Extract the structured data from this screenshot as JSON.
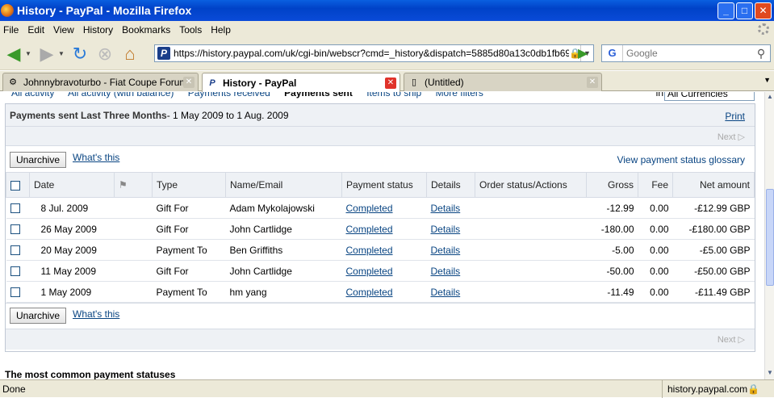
{
  "window": {
    "title": "History - PayPal - Mozilla Firefox",
    "minimize": "_",
    "maximize": "□",
    "close": "✕"
  },
  "menu": [
    "File",
    "Edit",
    "View",
    "History",
    "Bookmarks",
    "Tools",
    "Help"
  ],
  "nav": {
    "url": "https://history.paypal.com/uk/cgi-bin/webscr?cmd=_history&dispatch=5885d80a13c0db1fb69",
    "search_placeholder": "Google",
    "search_engine": "G"
  },
  "tabs": [
    {
      "label": "Johnnybravoturbo - Fiat Coupe Forum",
      "icon": "forum-icon",
      "active": false
    },
    {
      "label": "History - PayPal",
      "icon": "paypal-icon",
      "active": true
    },
    {
      "label": "(Untitled)",
      "icon": "page-icon",
      "active": false
    }
  ],
  "page": {
    "subnav": [
      "All activity",
      "All activity (with balance)",
      "Payments received",
      "Payments sent",
      "Items to ship",
      "More filters"
    ],
    "currency_label": "in",
    "currency_value": "All Currencies",
    "panel_title": "Payments sent Last Three Months",
    "panel_range": " - 1 May 2009 to 1 Aug. 2009",
    "print": "Print",
    "next": "Next",
    "unarchive": "Unarchive",
    "whats_this": "What's this",
    "glossary": "View payment status glossary",
    "columns": [
      "Date",
      "",
      "Type",
      "Name/Email",
      "Payment status",
      "Details",
      "Order status/Actions",
      "Gross",
      "Fee",
      "Net amount"
    ],
    "rows": [
      {
        "date": "8 Jul. 2009",
        "type": "Gift For",
        "name": "Adam Mykolajowski",
        "status": "Completed",
        "details": "Details",
        "gross": "-12.99",
        "fee": "0.00",
        "net": "-£12.99 GBP"
      },
      {
        "date": "26 May 2009",
        "type": "Gift For",
        "name": "John Cartlidge",
        "status": "Completed",
        "details": "Details",
        "gross": "-180.00",
        "fee": "0.00",
        "net": "-£180.00 GBP"
      },
      {
        "date": "20 May 2009",
        "type": "Payment To",
        "name": "Ben Griffiths",
        "status": "Completed",
        "details": "Details",
        "gross": "-5.00",
        "fee": "0.00",
        "net": "-£5.00 GBP"
      },
      {
        "date": "11 May 2009",
        "type": "Gift For",
        "name": "John Cartlidge",
        "status": "Completed",
        "details": "Details",
        "gross": "-50.00",
        "fee": "0.00",
        "net": "-£50.00 GBP"
      },
      {
        "date": "1 May 2009",
        "type": "Payment To",
        "name": "hm yang",
        "status": "Completed",
        "details": "Details",
        "gross": "-11.49",
        "fee": "0.00",
        "net": "-£11.49 GBP"
      }
    ],
    "common_statuses": "The most common payment statuses"
  },
  "status": {
    "text": "Done",
    "host": "history.paypal.com"
  }
}
